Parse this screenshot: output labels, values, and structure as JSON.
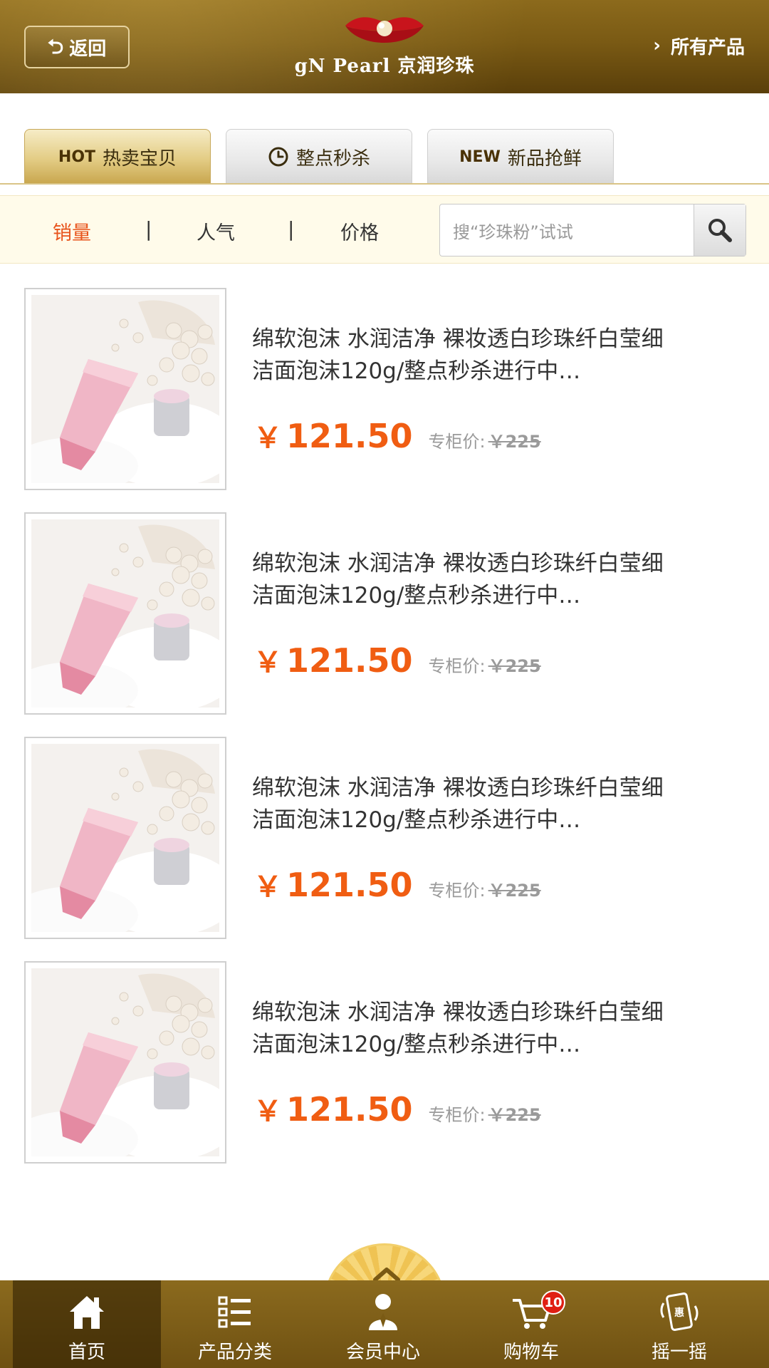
{
  "header": {
    "back_label": "返回",
    "brand_name": "gN Pearl 京润珍珠",
    "all_products_label": "所有产品"
  },
  "tabs": [
    {
      "tag": "HOT",
      "label": "热卖宝贝",
      "active": true
    },
    {
      "tag": "",
      "label": "整点秒杀",
      "active": false
    },
    {
      "tag": "NEW",
      "label": "新品抢鲜",
      "active": false
    }
  ],
  "filter": {
    "sort_options": [
      "销量",
      "人气",
      "价格"
    ],
    "active_sort": "销量",
    "separator": "|",
    "search_placeholder": "搜“珍珠粉”试试"
  },
  "products": [
    {
      "title": "绵软泡沫 水润洁净 裸妆透白珍珠纤白莹细洁面泡沫120g/整点秒杀进行中…",
      "price": "121.50",
      "currency": "￥",
      "orig_label": "专柜价:",
      "orig_price": "￥225"
    },
    {
      "title": "绵软泡沫 水润洁净 裸妆透白珍珠纤白莹细洁面泡沫120g/整点秒杀进行中…",
      "price": "121.50",
      "currency": "￥",
      "orig_label": "专柜价:",
      "orig_price": "￥225"
    },
    {
      "title": "绵软泡沫 水润洁净 裸妆透白珍珠纤白莹细洁面泡沫120g/整点秒杀进行中…",
      "price": "121.50",
      "currency": "￥",
      "orig_label": "专柜价:",
      "orig_price": "￥225"
    },
    {
      "title": "绵软泡沫 水润洁净 裸妆透白珍珠纤白莹细洁面泡沫120g/整点秒杀进行中…",
      "price": "121.50",
      "currency": "￥",
      "orig_label": "专柜价:",
      "orig_price": "￥225"
    }
  ],
  "bottom_nav": [
    {
      "label": "首页",
      "icon": "home-icon",
      "active": true
    },
    {
      "label": "产品分类",
      "icon": "category-list-icon",
      "active": false
    },
    {
      "label": "会员中心",
      "icon": "member-icon",
      "active": false
    },
    {
      "label": "购物车",
      "icon": "cart-icon",
      "active": false,
      "badge": "10"
    },
    {
      "label": "摇一摇",
      "icon": "shake-phone-icon",
      "active": false,
      "icon_text": "惠"
    }
  ],
  "colors": {
    "header_gold": "#7a5a14",
    "price_orange": "#f05d12",
    "active_sort": "#e8541c",
    "filter_bg": "#fffbea"
  }
}
